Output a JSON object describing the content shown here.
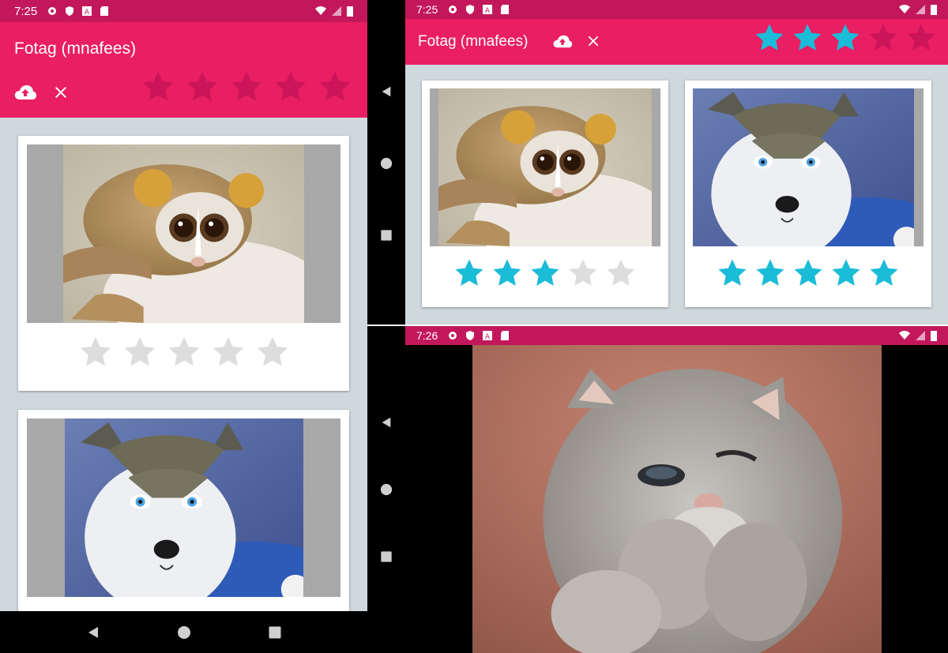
{
  "colors": {
    "status_bar": "#C2185B",
    "app_bar": "#E91E63",
    "background": "#CFD8DC",
    "star_filled": "#1ABCD8",
    "star_empty": "#DDDDDD",
    "star_header_empty": "#CC1558",
    "image_placeholder": "#A8A8A8"
  },
  "screen_portrait": {
    "status": {
      "time": "7:25"
    },
    "app": {
      "title": "Fotag (mnafees)"
    },
    "filter_rating": 0,
    "cards": [
      {
        "image": "slow-loris",
        "rating": 0
      },
      {
        "image": "husky-puppy",
        "rating": 0
      }
    ]
  },
  "screen_landscape": {
    "status": {
      "time": "7:25"
    },
    "app": {
      "title": "Fotag (mnafees)"
    },
    "filter_rating": 3,
    "cards": [
      {
        "image": "slow-loris",
        "rating": 3
      },
      {
        "image": "husky-puppy",
        "rating": 5
      }
    ]
  },
  "screen_fullscreen": {
    "status": {
      "time": "7:26"
    },
    "image": "kitten"
  },
  "icons": {
    "upload": "cloud-upload-icon",
    "clear": "close-icon",
    "star": "star-icon",
    "back": "back-triangle-icon",
    "home": "home-circle-icon",
    "recents": "recents-square-icon"
  }
}
